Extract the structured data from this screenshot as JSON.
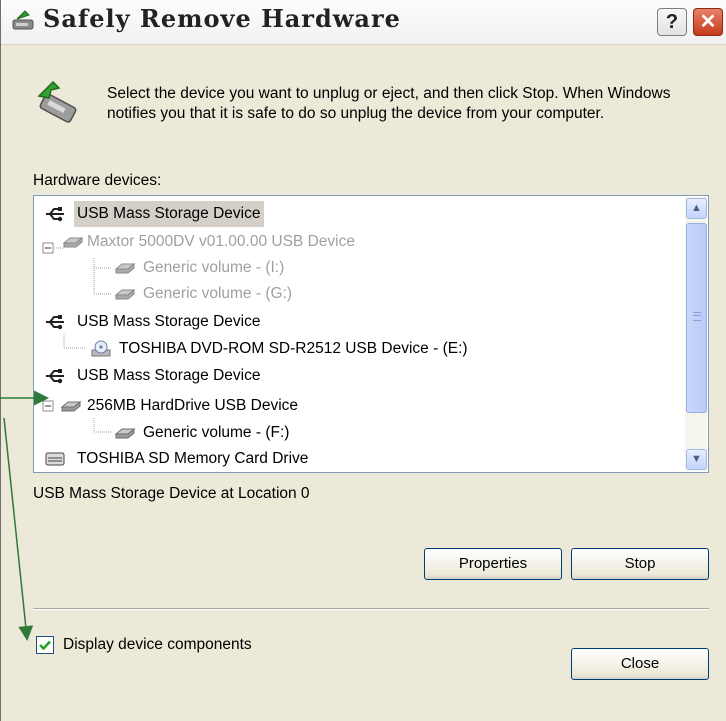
{
  "window": {
    "title": "Safely Remove Hardware",
    "help_glyph": "?",
    "close_glyph": "✕"
  },
  "instructions": "Select the device you want to unplug or eject, and then click Stop. When Windows notifies you that it is safe to do so unplug the device from your computer.",
  "hardware_label": "Hardware devices:",
  "devices": [
    {
      "label": "USB Mass Storage Device",
      "icon": "usb-plug-icon",
      "state": "selected"
    },
    {
      "label": "Maxtor 5000DV v01.00.00 USB Device",
      "icon": "disk-drive-icon",
      "state": "dimmed"
    },
    {
      "label": "Generic volume - (I:)",
      "icon": "disk-drive-icon",
      "state": "dimmed"
    },
    {
      "label": "Generic volume - (G:)",
      "icon": "disk-drive-icon",
      "state": "dimmed"
    },
    {
      "label": "USB Mass Storage Device",
      "icon": "usb-plug-icon",
      "state": "normal"
    },
    {
      "label": "TOSHIBA DVD-ROM SD-R2512 USB Device - (E:)",
      "icon": "cd-drive-icon",
      "state": "normal"
    },
    {
      "label": "USB Mass Storage Device",
      "icon": "usb-plug-icon",
      "state": "normal"
    },
    {
      "label": "256MB HardDrive USB Device",
      "icon": "disk-drive-icon",
      "state": "normal"
    },
    {
      "label": "Generic volume - (F:)",
      "icon": "disk-drive-icon",
      "state": "normal"
    },
    {
      "label": "TOSHIBA SD Memory Card Drive",
      "icon": "card-reader-icon",
      "state": "normal"
    }
  ],
  "location_text": "USB Mass Storage Device at Location 0",
  "buttons": {
    "properties": "Properties",
    "stop": "Stop",
    "close": "Close"
  },
  "checkbox": {
    "label": "Display device components",
    "checked": true
  },
  "colors": {
    "dialog_bg": "#ece9d8",
    "selection_bg": "#d4d0c8",
    "annotation_arrow": "#2f7a3a",
    "checkmark": "#21a121"
  }
}
